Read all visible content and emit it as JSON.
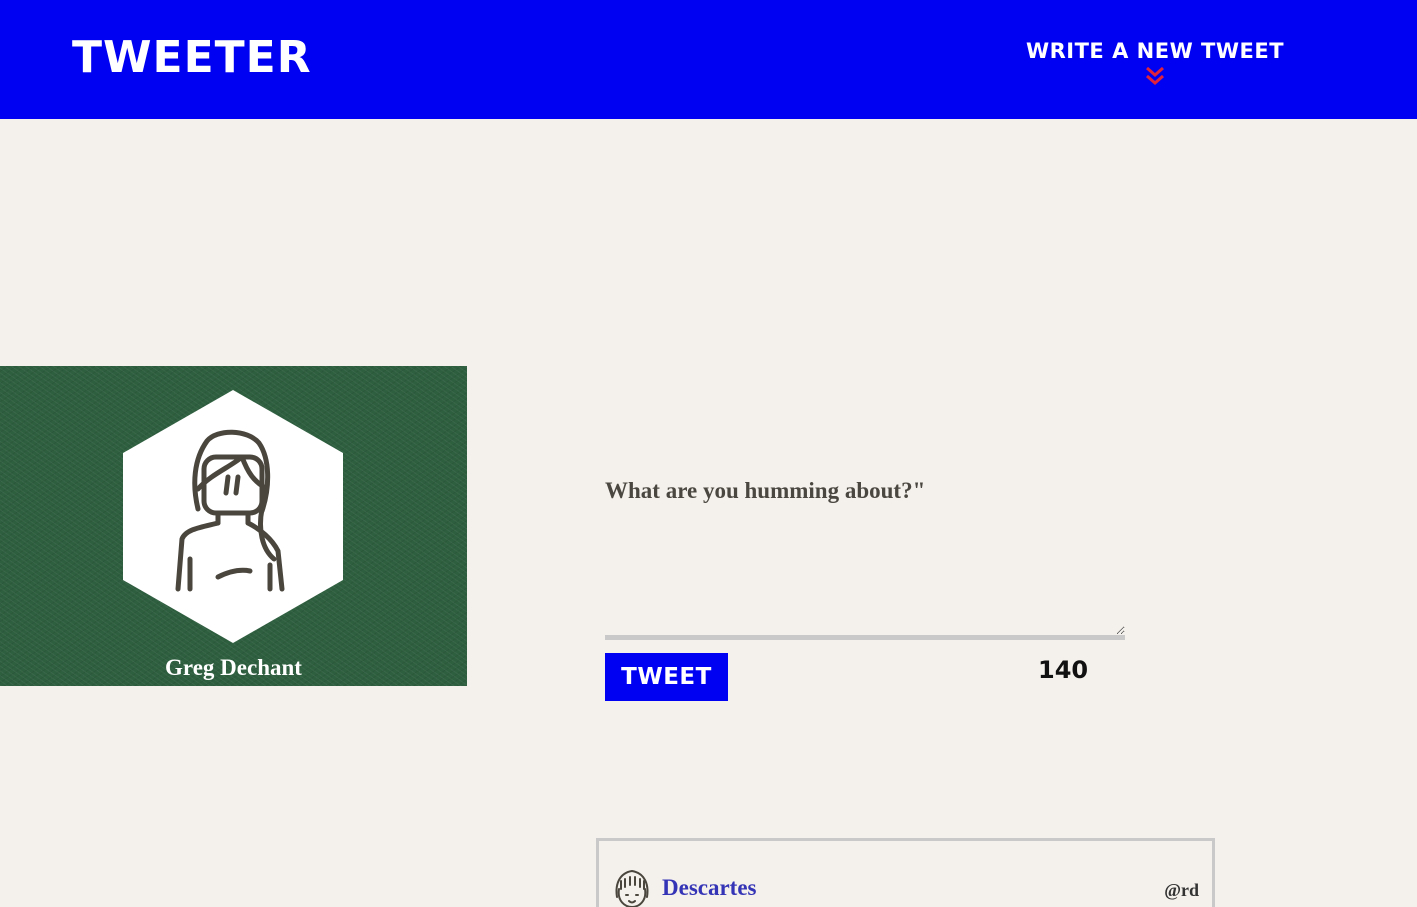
{
  "nav": {
    "brand": "TWEETER",
    "compose_toggle_label": "WRITE A NEW TWEET",
    "compose_toggle_icon": "double-chevron-down-icon"
  },
  "profile": {
    "name": "Greg Dechant",
    "avatar_icon": "user-avatar-icon"
  },
  "compose": {
    "placeholder": "What are you humming about?\"",
    "value": "",
    "submit_label": "TWEET",
    "char_counter": "140"
  },
  "tweets": [
    {
      "author": "Descartes",
      "handle": "@rd",
      "avatar_icon": "user-avatar-icon"
    }
  ],
  "colors": {
    "primary": "#0000f3",
    "background": "#f4f1ec",
    "profile_bg": "#2e5f3f",
    "chevron": "#e0233c",
    "author_name": "#3434b6"
  }
}
